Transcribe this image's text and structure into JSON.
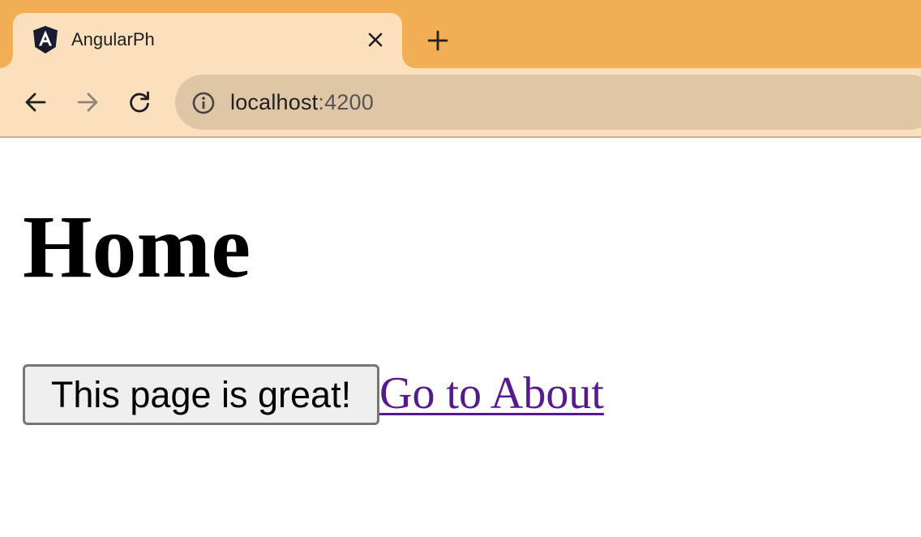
{
  "browser": {
    "tab": {
      "title": "AngularPh",
      "favicon": "angular-logo-icon"
    },
    "address_bar": {
      "host": "localhost",
      "port": ":4200"
    },
    "icons": {
      "back": "arrow-left-icon",
      "forward": "arrow-right-icon",
      "reload": "reload-icon",
      "info": "info-icon",
      "close_tab": "close-icon",
      "new_tab": "plus-icon"
    },
    "colors": {
      "tabstrip": "#f3af55",
      "toolbar": "#fbe0bd",
      "omnibox": "#dec6a7"
    }
  },
  "page": {
    "title": "Home",
    "button_label": "This page is great!",
    "link_label": "Go to About",
    "colors": {
      "link": "#551a8b"
    }
  }
}
